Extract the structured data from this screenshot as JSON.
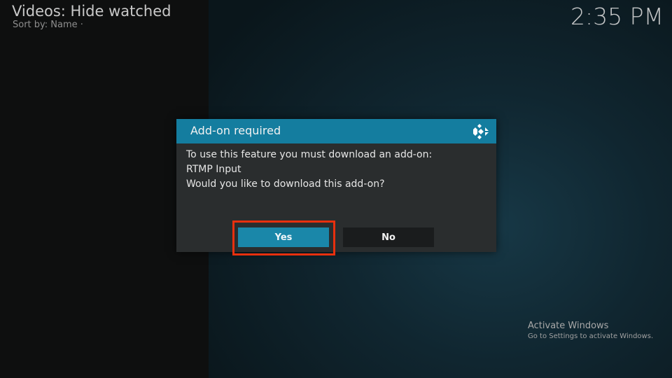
{
  "header": {
    "title": "Videos: Hide watched",
    "sort": "Sort by: Name  ·"
  },
  "clock": "2:35 PM",
  "dialog": {
    "title": "Add-on required",
    "logo_icon": "kodi-logo-icon",
    "lines": [
      "To use this feature you must download an add-on:",
      "RTMP Input",
      "Would you like to download this add-on?"
    ],
    "yes_label": "Yes",
    "no_label": "No"
  },
  "watermark": {
    "title": "Activate Windows",
    "subtitle": "Go to Settings to activate Windows."
  },
  "colors": {
    "accent": "#147d9f",
    "highlight": "#e8300e",
    "dialog_bg": "#2a2d2e"
  }
}
